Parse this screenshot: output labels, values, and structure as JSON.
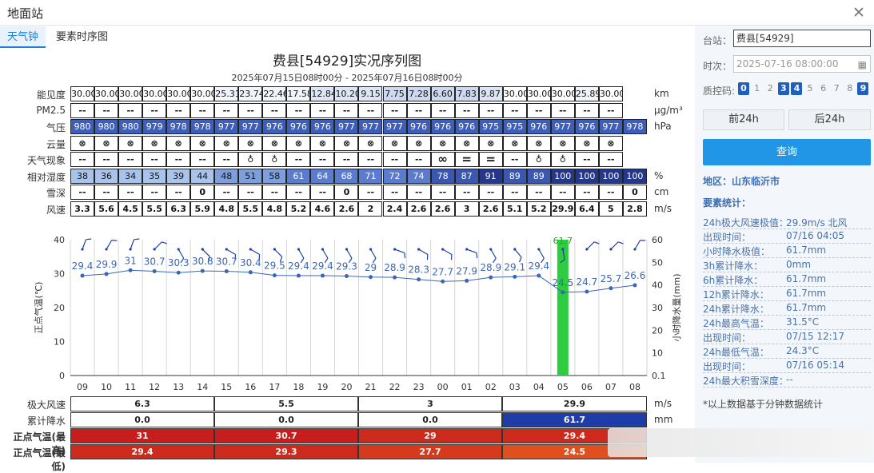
{
  "window": {
    "title": "地面站"
  },
  "tabs": [
    {
      "label": "天气钟"
    },
    {
      "label": "要素时序图"
    }
  ],
  "chart_title": "费县[54929]实况序列图",
  "chart_subtitle": "2025年07月15日08时00分 - 2025年07月16日08时00分",
  "table": {
    "rows": [
      {
        "label": "能见度",
        "unit": "km",
        "kind": "vis",
        "values": [
          "30.00",
          "30.00",
          "30.00",
          "30.00",
          "30.00",
          "30.00",
          "25.31",
          "23.74",
          "22.46",
          "17.58",
          "12.84",
          "10.20",
          "9.15",
          "7.75",
          "7.28",
          "6.60",
          "7.83",
          "9.87",
          "30.00",
          "30.00",
          "30.00",
          "25.89",
          "30.00"
        ]
      },
      {
        "label": "PM2.5",
        "unit": "μg/m³",
        "kind": "plain",
        "values": [
          "--",
          "--",
          "--",
          "--",
          "--",
          "--",
          "--",
          "--",
          "--",
          "--",
          "--",
          "--",
          "--",
          "--",
          "--",
          "--",
          "--",
          "--",
          "--",
          "--",
          "--",
          "--",
          "--"
        ]
      },
      {
        "label": "气压",
        "unit": "hPa",
        "kind": "pres",
        "values": [
          "980",
          "980",
          "980",
          "979",
          "978",
          "978",
          "977",
          "977",
          "976",
          "976",
          "976",
          "977",
          "977",
          "977",
          "976",
          "976",
          "976",
          "975",
          "975",
          "976",
          "977",
          "976",
          "977",
          "978"
        ]
      },
      {
        "label": "云量",
        "unit": "",
        "kind": "plain",
        "values": [
          "⊗",
          "⊗",
          "⊗",
          "⊗",
          "⊗",
          "⊗",
          "⊗",
          "⊗",
          "⊗",
          "⊗",
          "⊗",
          "⊗",
          "⊗",
          "⊗",
          "⊗",
          "⊗",
          "⊗",
          "⊗",
          "⊗",
          "⊗",
          "⊗",
          "⊗",
          "⊗"
        ]
      },
      {
        "label": "天气现象",
        "unit": "",
        "kind": "plain",
        "values": [
          "--",
          "--",
          "--",
          "--",
          "--",
          "--",
          "--",
          "♁",
          "♁",
          "--",
          "--",
          "--",
          "--",
          "--",
          "--",
          "∞",
          "=",
          "=",
          "--",
          "♁",
          "♁",
          "--",
          "--"
        ]
      },
      {
        "label": "相对湿度",
        "unit": "%",
        "kind": "rh",
        "values": [
          "38",
          "36",
          "34",
          "35",
          "39",
          "44",
          "48",
          "51",
          "58",
          "61",
          "64",
          "68",
          "71",
          "72",
          "74",
          "78",
          "87",
          "91",
          "89",
          "89",
          "100",
          "100",
          "100",
          "100"
        ]
      },
      {
        "label": "雪深",
        "unit": "cm",
        "kind": "plain",
        "values": [
          "--",
          "--",
          "--",
          "--",
          "--",
          "0",
          "--",
          "--",
          "--",
          "--",
          "--",
          "0",
          "--",
          "--",
          "--",
          "--",
          "--",
          "--",
          "--",
          "--",
          "--",
          "--",
          "--",
          "0"
        ]
      },
      {
        "label": "风速",
        "unit": "m/s",
        "kind": "plain",
        "values": [
          "3.3",
          "5.6",
          "4.5",
          "5.5",
          "6.3",
          "5.9",
          "4.8",
          "5.5",
          "4.8",
          "5.2",
          "4.6",
          "2.6",
          "2",
          "2.4",
          "2.6",
          "2.6",
          "3",
          "2.6",
          "5.1",
          "5.2",
          "29.9",
          "6.4",
          "5",
          "2.8"
        ]
      }
    ]
  },
  "chart_data": {
    "type": "line",
    "x": [
      "09",
      "10",
      "11",
      "12",
      "13",
      "14",
      "15",
      "16",
      "17",
      "18",
      "19",
      "20",
      "21",
      "22",
      "23",
      "00",
      "01",
      "02",
      "03",
      "04",
      "05",
      "06",
      "07",
      "08"
    ],
    "series": [
      {
        "name": "正点气温(℃)",
        "axis": "left",
        "values": [
          29.4,
          29.9,
          31,
          30.7,
          30.3,
          30.8,
          30.7,
          30.4,
          29.5,
          29.4,
          29.4,
          29.3,
          29,
          28.9,
          28.3,
          27.7,
          27.9,
          28.9,
          29.1,
          29.4,
          24.5,
          24.7,
          25.7,
          26.6
        ],
        "labels": [
          "29.4",
          "29.9",
          "31",
          "30.7",
          "30.3",
          "30.8",
          "30.7",
          "30.4",
          "29.5",
          "29.4",
          "29.4",
          "29.3",
          "29",
          "28.9",
          "28.3",
          "27.7",
          "27.9",
          "28.9",
          "29.1",
          "29.4",
          "24.5",
          "24.7",
          "25.7",
          "26.6"
        ],
        "color": "#3a66b7"
      },
      {
        "name": "小时降水量(mm)",
        "axis": "right",
        "type": "bar",
        "values": [
          0,
          0,
          0,
          0,
          0,
          0,
          0,
          0,
          0,
          0,
          0,
          0,
          0,
          0,
          0,
          0,
          0,
          0,
          0,
          0,
          61.7,
          0,
          0,
          0
        ],
        "label_text": "61.7",
        "color": "#2ecc40"
      }
    ],
    "ylabel_left": "正点气温(℃)",
    "ylim_left": [
      0,
      40
    ],
    "yticks_left": [
      "0",
      "10",
      "20",
      "30",
      "40"
    ],
    "ylabel_right": "小时降水量(mm)",
    "yticks_right": [
      "0.1",
      "10",
      "20",
      "30",
      "40",
      "50",
      "60"
    ],
    "wind_dir_deg": [
      200,
      210,
      200,
      225,
      330,
      315,
      300,
      300,
      315,
      330,
      330,
      330,
      330,
      290,
      300,
      300,
      290,
      330,
      320,
      330,
      350,
      225,
      225,
      210
    ],
    "grid": true
  },
  "bottom": {
    "rows": [
      {
        "label": "极大风速",
        "unit": "m/s",
        "cells": [
          "6.3",
          "5.5",
          "3",
          "29.9"
        ],
        "colors": [
          "#ffffff",
          "#ffffff",
          "#ffffff",
          "#ffffff"
        ],
        "text_colors": [
          "#222",
          "#222",
          "#222",
          "#222"
        ]
      },
      {
        "label": "累计降水",
        "unit": "mm",
        "cells": [
          "0.0",
          "0.0",
          "0.0",
          "61.7"
        ],
        "colors": [
          "#ffffff",
          "#ffffff",
          "#ffffff",
          "#1f3da8"
        ],
        "text_colors": [
          "#222",
          "#222",
          "#222",
          "#ffffff"
        ]
      },
      {
        "label": "正点气温(最高)",
        "unit": "",
        "cells": [
          "31",
          "30.7",
          "29",
          "29.4"
        ],
        "colors": [
          "#c81d1d",
          "#c81d1d",
          "#cc2a1d",
          "#cc2a1d"
        ],
        "text_colors": [
          "#ffffff",
          "#ffffff",
          "#ffffff",
          "#ffffff"
        ]
      },
      {
        "label": "正点气温(最低)",
        "unit": "",
        "cells": [
          "29.4",
          "29.3",
          "27.7",
          "24.5"
        ],
        "colors": [
          "#cc2a1d",
          "#cc2a1d",
          "#d63a1d",
          "#e0501e"
        ],
        "text_colors": [
          "#ffffff",
          "#ffffff",
          "#ffffff",
          "#ffffff"
        ]
      }
    ]
  },
  "side": {
    "station_label": "台站：",
    "station_value": "费县[54929]",
    "time_label": "时次：",
    "time_value": "2025-07-16 08:00:00",
    "qc_label": "质控码:",
    "qc_codes": [
      {
        "v": "0",
        "on": true
      },
      {
        "v": "1",
        "on": false
      },
      {
        "v": "2",
        "on": false
      },
      {
        "v": "3",
        "on": true
      },
      {
        "v": "4",
        "on": true
      },
      {
        "v": "5",
        "on": false
      },
      {
        "v": "6",
        "on": false
      },
      {
        "v": "7",
        "on": false
      },
      {
        "v": "8",
        "on": false
      },
      {
        "v": "9",
        "on": true
      }
    ],
    "prev_label": "前24h",
    "next_label": "后24h",
    "query_label": "查询",
    "region": "地区：山东临沂市",
    "stats_header": "要素统计：",
    "stats": [
      {
        "k": "24h极大风速极值：",
        "v": "29.9m/s 北风"
      },
      {
        "k": "出现时间：",
        "v": "07/16 04:05"
      },
      {
        "k": "小时降水极值：",
        "v": "61.7mm"
      },
      {
        "k": "3h累计降水：",
        "v": "0mm"
      },
      {
        "k": "6h累计降水：",
        "v": "61.7mm"
      },
      {
        "k": "12h累计降水：",
        "v": "61.7mm"
      },
      {
        "k": "24h累计降水：",
        "v": "61.7mm"
      },
      {
        "k": "24h最高气温：",
        "v": "31.5°C"
      },
      {
        "k": "出现时间：",
        "v": "07/15 12:17"
      },
      {
        "k": "24h最低气温：",
        "v": "24.3°C"
      },
      {
        "k": "出现时间：",
        "v": "07/16 05:14"
      },
      {
        "k": "24h最大积雪深度：",
        "v": "--"
      }
    ],
    "note": "*以上数据基于分钟数据统计"
  }
}
